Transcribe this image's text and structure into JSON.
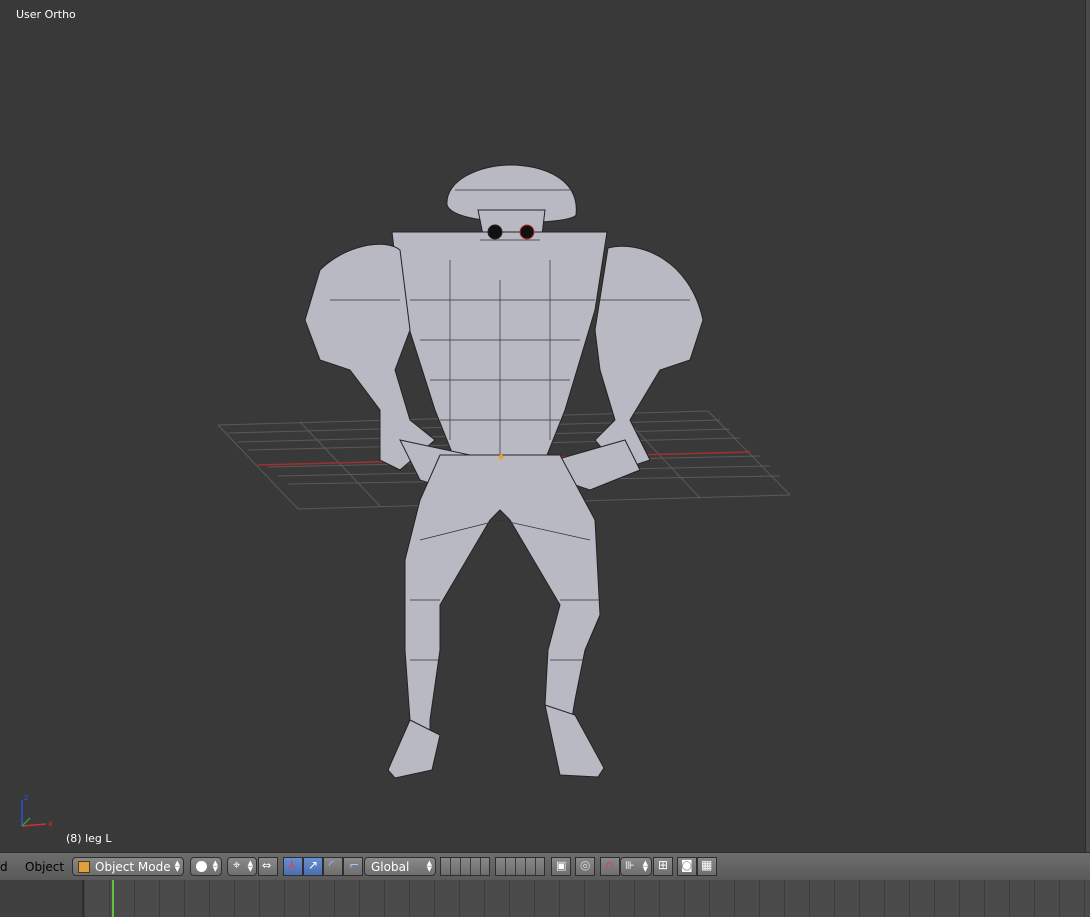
{
  "viewport": {
    "view_label": "User Ortho",
    "object_info": "(8) leg L"
  },
  "header": {
    "partial_menu": "d",
    "object_menu": "Object",
    "mode": "Object Mode",
    "orientation": "Global"
  },
  "colors": {
    "viewport_bg": "#393939",
    "header_bg": "#6d6d6d",
    "timeline_bg": "#4b4b4b",
    "current_frame_line": "#60c040",
    "active_button": "#5a80c4",
    "grid_x_axis": "#a03030"
  },
  "icons": [
    "axis-gizmo-icon",
    "object-cube-icon",
    "shading-sphere-icon",
    "pivot-icon",
    "manipulator-icon",
    "translate-icon",
    "rotate-icon",
    "scale-icon",
    "layers-icon",
    "lock-icon",
    "proportional-icon",
    "magnet-icon",
    "snap-icon",
    "render-icon",
    "animation-icon"
  ]
}
